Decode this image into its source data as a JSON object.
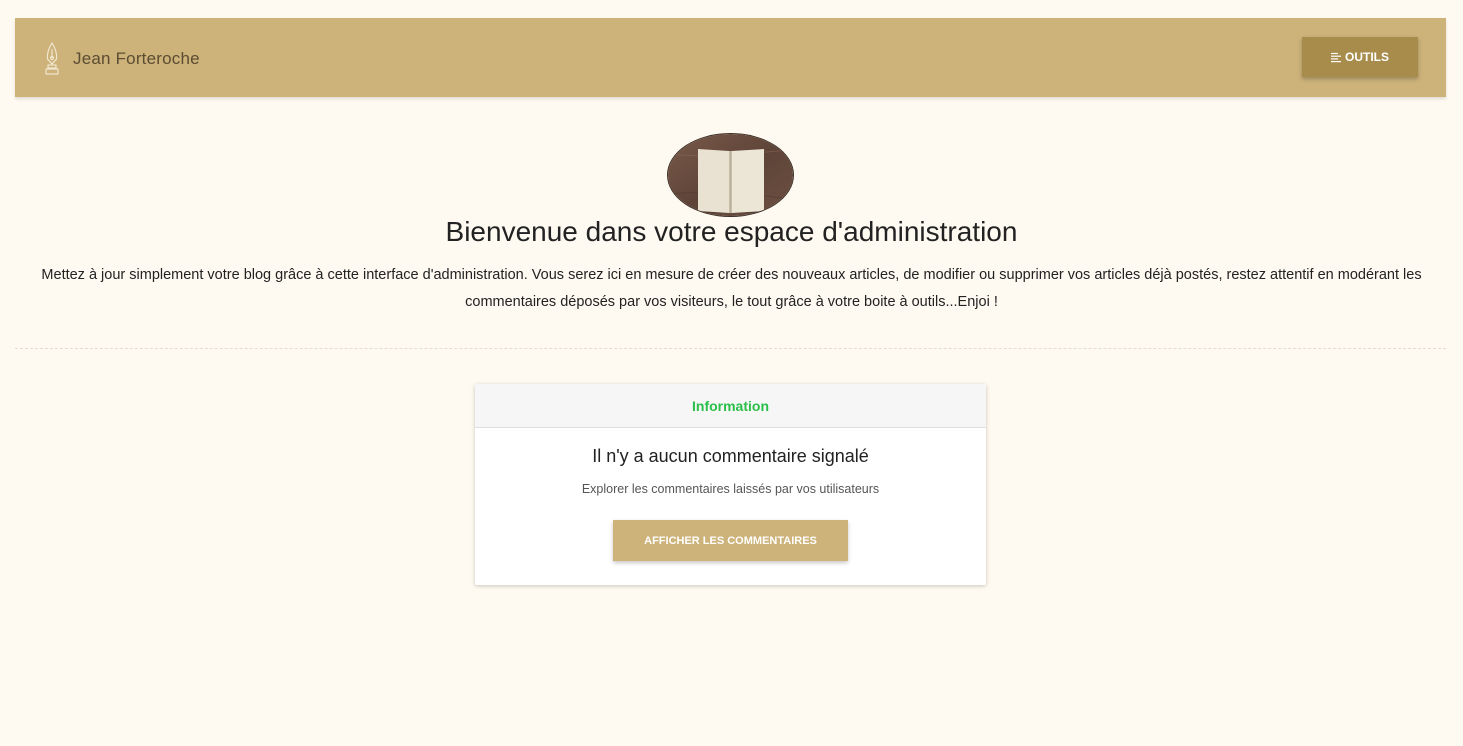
{
  "navbar": {
    "brand_name": "Jean Forteroche",
    "brand_icon": "fountain-pen-icon",
    "tools_label": "OUTILS",
    "tools_icon": "list-icon"
  },
  "hero": {
    "image": "open-book-photo",
    "title": "Bienvenue dans votre espace d'administration",
    "description": "Mettez à jour simplement votre blog grâce à cette interface d'administration. Vous serez ici en mesure de créer des nouveaux articles, de modifier ou supprimer vos articles déjà postés, restez attentif en modérant les commentaires déposés par vos visiteurs, le tout grâce à votre boite à outils...Enjoi !"
  },
  "card": {
    "header": "Information",
    "title": "Il n'y a aucun commentaire signalé",
    "text": "Explorer les commentaires laissés par vos utilisateurs",
    "button_label": "AFFICHER LES COMMENTAIRES"
  },
  "colors": {
    "page_background": "#fffaf1",
    "navbar": "#cdb37a",
    "tools_button": "#a88c4b",
    "card_header_text": "#2bbf49",
    "card_button": "#cdb37a"
  }
}
